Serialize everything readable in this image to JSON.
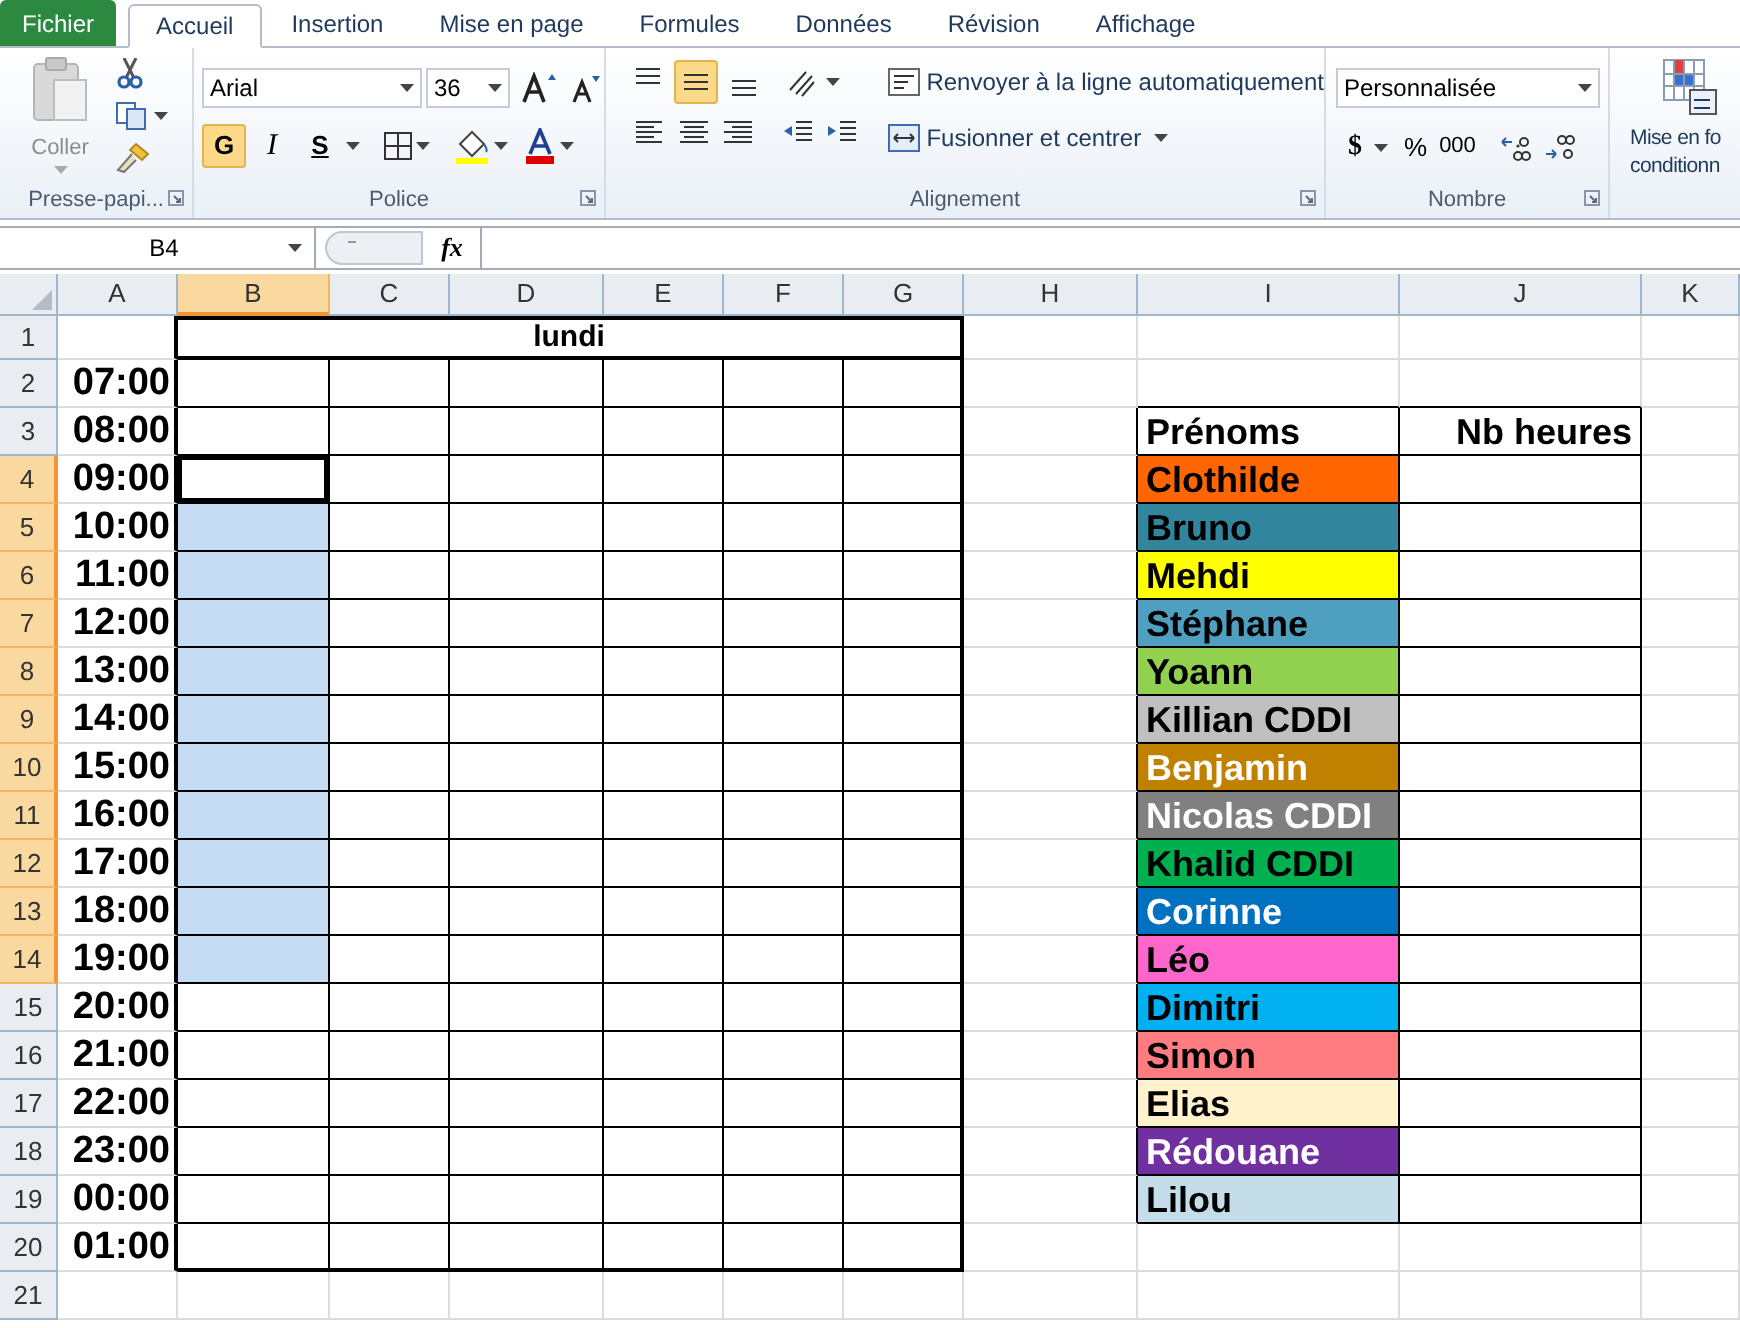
{
  "ribbon_tabs": [
    {
      "label": "Fichier",
      "kind": "file",
      "selected": false
    },
    {
      "label": "Accueil",
      "kind": "tab",
      "selected": true
    },
    {
      "label": "Insertion",
      "kind": "tab",
      "selected": false
    },
    {
      "label": "Mise en page",
      "kind": "tab",
      "selected": false
    },
    {
      "label": "Formules",
      "kind": "tab",
      "selected": false
    },
    {
      "label": "Données",
      "kind": "tab",
      "selected": false
    },
    {
      "label": "Révision",
      "kind": "tab",
      "selected": false
    },
    {
      "label": "Affichage",
      "kind": "tab",
      "selected": false
    }
  ],
  "clipboard": {
    "paste_label": "Coller",
    "group_label": "Presse-papi..."
  },
  "font": {
    "name": "Arial",
    "size": "36",
    "group_label": "Police",
    "styles": [
      {
        "label": "G",
        "kind": "bold",
        "pressed": true
      },
      {
        "label": "I",
        "kind": "italic",
        "pressed": false
      },
      {
        "label": "S",
        "kind": "underline",
        "pressed": false
      }
    ]
  },
  "alignment": {
    "group_label": "Alignement",
    "wrap_label": "Renvoyer à la ligne automatiquement",
    "merge_label": "Fusionner et centrer",
    "vertical": [
      {
        "kind": "top",
        "selected": false
      },
      {
        "kind": "middle",
        "selected": true
      },
      {
        "kind": "bottom",
        "selected": false
      }
    ]
  },
  "number": {
    "group_label": "Nombre",
    "format": "Personnalisée",
    "currency": "$",
    "percent": "%",
    "thousands": "000"
  },
  "styles": {
    "conditional_label": [
      "Mise en fo",
      "conditionn"
    ]
  },
  "formula_bar": {
    "name_box": "B4",
    "fx": "fx"
  },
  "sheet": {
    "columns": [
      {
        "label": "A",
        "selected": false
      },
      {
        "label": "B",
        "selected": true
      },
      {
        "label": "C",
        "selected": false
      },
      {
        "label": "D",
        "selected": false
      },
      {
        "label": "E",
        "selected": false
      },
      {
        "label": "F",
        "selected": false
      },
      {
        "label": "G",
        "selected": false
      },
      {
        "label": "H",
        "selected": false
      },
      {
        "label": "I",
        "selected": false
      },
      {
        "label": "J",
        "selected": false
      },
      {
        "label": "K",
        "selected": false
      }
    ],
    "rows": [
      {
        "label": "1",
        "selected": false
      },
      {
        "label": "2",
        "selected": false
      },
      {
        "label": "3",
        "selected": false
      },
      {
        "label": "4",
        "selected": true
      },
      {
        "label": "5",
        "selected": true
      },
      {
        "label": "6",
        "selected": true
      },
      {
        "label": "7",
        "selected": true
      },
      {
        "label": "8",
        "selected": true
      },
      {
        "label": "9",
        "selected": true
      },
      {
        "label": "10",
        "selected": true
      },
      {
        "label": "11",
        "selected": true
      },
      {
        "label": "12",
        "selected": true
      },
      {
        "label": "13",
        "selected": true
      },
      {
        "label": "14",
        "selected": true
      },
      {
        "label": "15",
        "selected": false
      },
      {
        "label": "16",
        "selected": false
      },
      {
        "label": "17",
        "selected": false
      },
      {
        "label": "18",
        "selected": false
      },
      {
        "label": "19",
        "selected": false
      },
      {
        "label": "20",
        "selected": false
      },
      {
        "label": "21",
        "selected": false
      }
    ],
    "day_title": "lundi",
    "times": [
      {
        "time": "07:00",
        "selected": false,
        "active": false
      },
      {
        "time": "08:00",
        "selected": false,
        "active": false
      },
      {
        "time": "09:00",
        "selected": false,
        "active": true
      },
      {
        "time": "10:00",
        "selected": true,
        "active": false
      },
      {
        "time": "11:00",
        "selected": true,
        "active": false
      },
      {
        "time": "12:00",
        "selected": true,
        "active": false
      },
      {
        "time": "13:00",
        "selected": true,
        "active": false
      },
      {
        "time": "14:00",
        "selected": true,
        "active": false
      },
      {
        "time": "15:00",
        "selected": true,
        "active": false
      },
      {
        "time": "16:00",
        "selected": true,
        "active": false
      },
      {
        "time": "17:00",
        "selected": true,
        "active": false
      },
      {
        "time": "18:00",
        "selected": true,
        "active": false
      },
      {
        "time": "19:00",
        "selected": true,
        "active": false
      },
      {
        "time": "20:00",
        "selected": false,
        "active": false
      },
      {
        "time": "21:00",
        "selected": false,
        "active": false
      },
      {
        "time": "22:00",
        "selected": false,
        "active": false
      },
      {
        "time": "23:00",
        "selected": false,
        "active": false
      },
      {
        "time": "00:00",
        "selected": false,
        "active": false
      },
      {
        "time": "01:00",
        "selected": false,
        "active": false
      }
    ],
    "names_header": [
      "Prénoms",
      "Nb heures"
    ],
    "people": [
      {
        "name": "Clothilde",
        "color": "#ff6600",
        "light_text": false
      },
      {
        "name": "Bruno",
        "color": "#31859c",
        "light_text": false
      },
      {
        "name": "Mehdi",
        "color": "#ffff00",
        "light_text": false
      },
      {
        "name": "Stéphane",
        "color": "#4f9fc0",
        "light_text": false
      },
      {
        "name": "Yoann",
        "color": "#92d050",
        "light_text": false
      },
      {
        "name": "Killian CDDI",
        "color": "#c0c0c0",
        "light_text": false
      },
      {
        "name": "Benjamin",
        "color": "#c08000",
        "light_text": true
      },
      {
        "name": "Nicolas CDDI",
        "color": "#808080",
        "light_text": true
      },
      {
        "name": "Khalid CDDI",
        "color": "#00b050",
        "light_text": false
      },
      {
        "name": "Corinne",
        "color": "#0070c0",
        "light_text": true
      },
      {
        "name": "Léo",
        "color": "#ff66cc",
        "light_text": false
      },
      {
        "name": "Dimitri",
        "color": "#00b0f0",
        "light_text": false
      },
      {
        "name": "Simon",
        "color": "#ff7c80",
        "light_text": false
      },
      {
        "name": "Elias",
        "color": "#fff2cc",
        "light_text": false
      },
      {
        "name": "Rédouane",
        "color": "#7030a0",
        "light_text": true
      },
      {
        "name": "Lilou",
        "color": "#c5dde8",
        "light_text": false
      }
    ]
  }
}
